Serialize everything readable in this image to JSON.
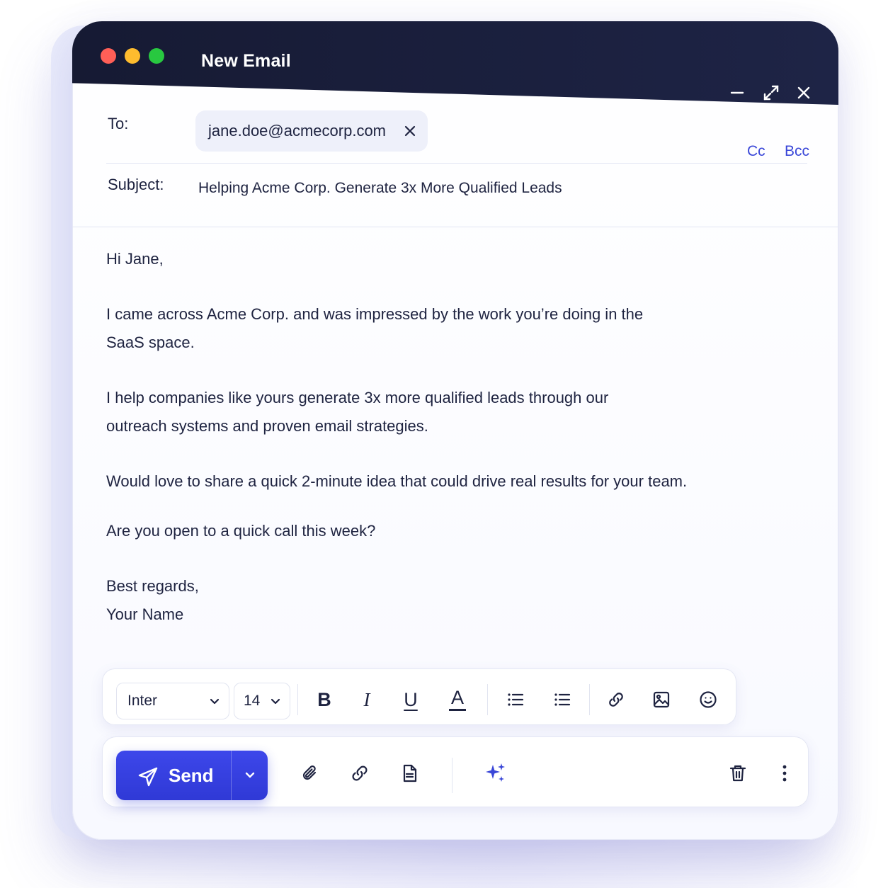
{
  "window": {
    "title": "New Email"
  },
  "header": {
    "to_label": "To:",
    "recipient": "jane.doe@acmecorp.com",
    "cc_label": "Cc",
    "bcc_label": "Bcc",
    "subject_label": "Subject:",
    "subject": "Helping Acme Corp. Generate 3x More Qualified Leads"
  },
  "body": {
    "greeting": "Hi Jane,",
    "para1_line1": "I came across Acme Corp. and was impressed by the work you’re doing in the",
    "para1_line2": "SaaS space.",
    "para2_line1": "I help companies like yours generate 3x more qualified leads through our",
    "para2_line2": "outreach systems and proven email strategies.",
    "para3": "Would love to share a quick 2-minute idea that could drive real results for your team.",
    "para4": "Are you open to a quick call this week?",
    "closing": "Best regards,",
    "signature": "Your Name"
  },
  "format_toolbar": {
    "font": "Inter",
    "size": "14",
    "bold": "B",
    "italic": "I",
    "underline": "U",
    "text_color": "A"
  },
  "actions": {
    "send_label": "Send"
  },
  "colors": {
    "titlebar": "#161a33",
    "accent": "#3a47d8",
    "send_button": "#3d47ea",
    "text": "#1e2340"
  },
  "icons": {
    "window_controls": [
      "minimize-icon",
      "expand-icon",
      "close-icon"
    ],
    "format": [
      "chevron-down-icon",
      "bullet-list-icon",
      "numbered-list-icon",
      "link-icon",
      "image-icon",
      "emoji-icon"
    ],
    "actions": [
      "send-icon",
      "chevron-down-icon",
      "paperclip-icon",
      "link-icon",
      "document-icon",
      "sparkles-icon",
      "trash-icon",
      "more-vertical-icon"
    ]
  }
}
